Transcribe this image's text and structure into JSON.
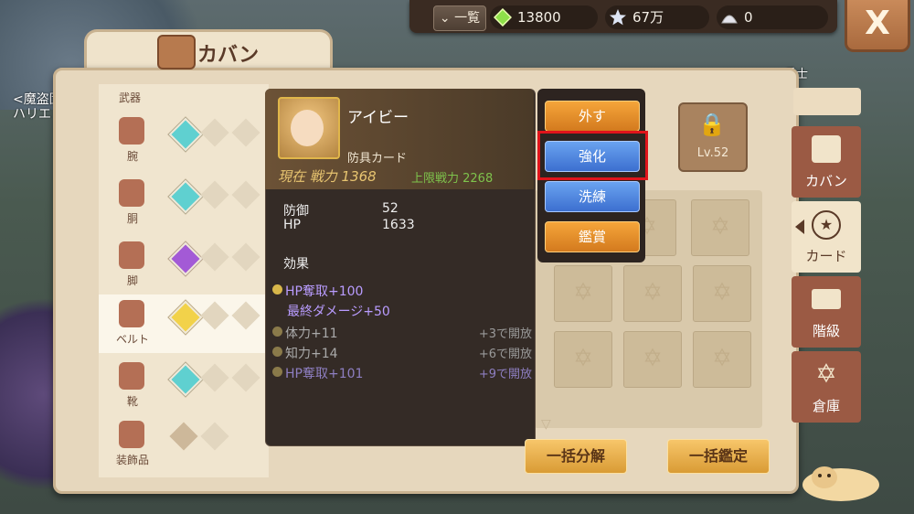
{
  "topbar": {
    "list_label": "一覧",
    "gem_value": "13800",
    "star_value": "67万",
    "shell_value": "0",
    "close_label": "X"
  },
  "background": {
    "left_label_1": "<魔盗団",
    "left_label_2": "ハリエ",
    "soldier_label": "兵士"
  },
  "panel": {
    "title": "カバン",
    "weapon_label": "武器",
    "slots": [
      {
        "label": "腕"
      },
      {
        "label": "胴"
      },
      {
        "label": "脚"
      },
      {
        "label": "ベルト"
      },
      {
        "label": "靴"
      },
      {
        "label": "装飾品"
      }
    ]
  },
  "card": {
    "name": "アイビー",
    "type": "防具カード",
    "power_label": "現在 戦力 1368",
    "max_power_label": "上限戦力 2268",
    "stats": [
      {
        "key": "防御",
        "value": "52"
      },
      {
        "key": "HP",
        "value": "1633"
      }
    ],
    "effect_header": "効果",
    "effects": [
      {
        "text": "HP奪取+100",
        "req": ""
      },
      {
        "text": "最終ダメージ+50",
        "req": ""
      },
      {
        "text": "体力+11",
        "req": "+3で開放"
      },
      {
        "text": "知力+14",
        "req": "+6で開放"
      },
      {
        "text": "HP奪取+101",
        "req": "+9で開放"
      }
    ]
  },
  "menu": {
    "remove": "外す",
    "enhance": "強化",
    "refine": "洗練",
    "appraise": "鑑賞"
  },
  "lock": {
    "level": "Lv.52"
  },
  "buttons": {
    "bulk_disassemble": "一括分解",
    "bulk_appraise": "一括鑑定"
  },
  "sidetabs": {
    "bag": "カバン",
    "card": "カード",
    "rank": "階級",
    "storage": "倉庫"
  },
  "colors": {
    "accent_orange": "#f5a53a",
    "accent_blue": "#3c6fd0",
    "highlight_red": "#e0141b",
    "gem_teal": "#5fd0d0",
    "gem_purple": "#a35ad6",
    "gem_yellow": "#f2d24a"
  }
}
